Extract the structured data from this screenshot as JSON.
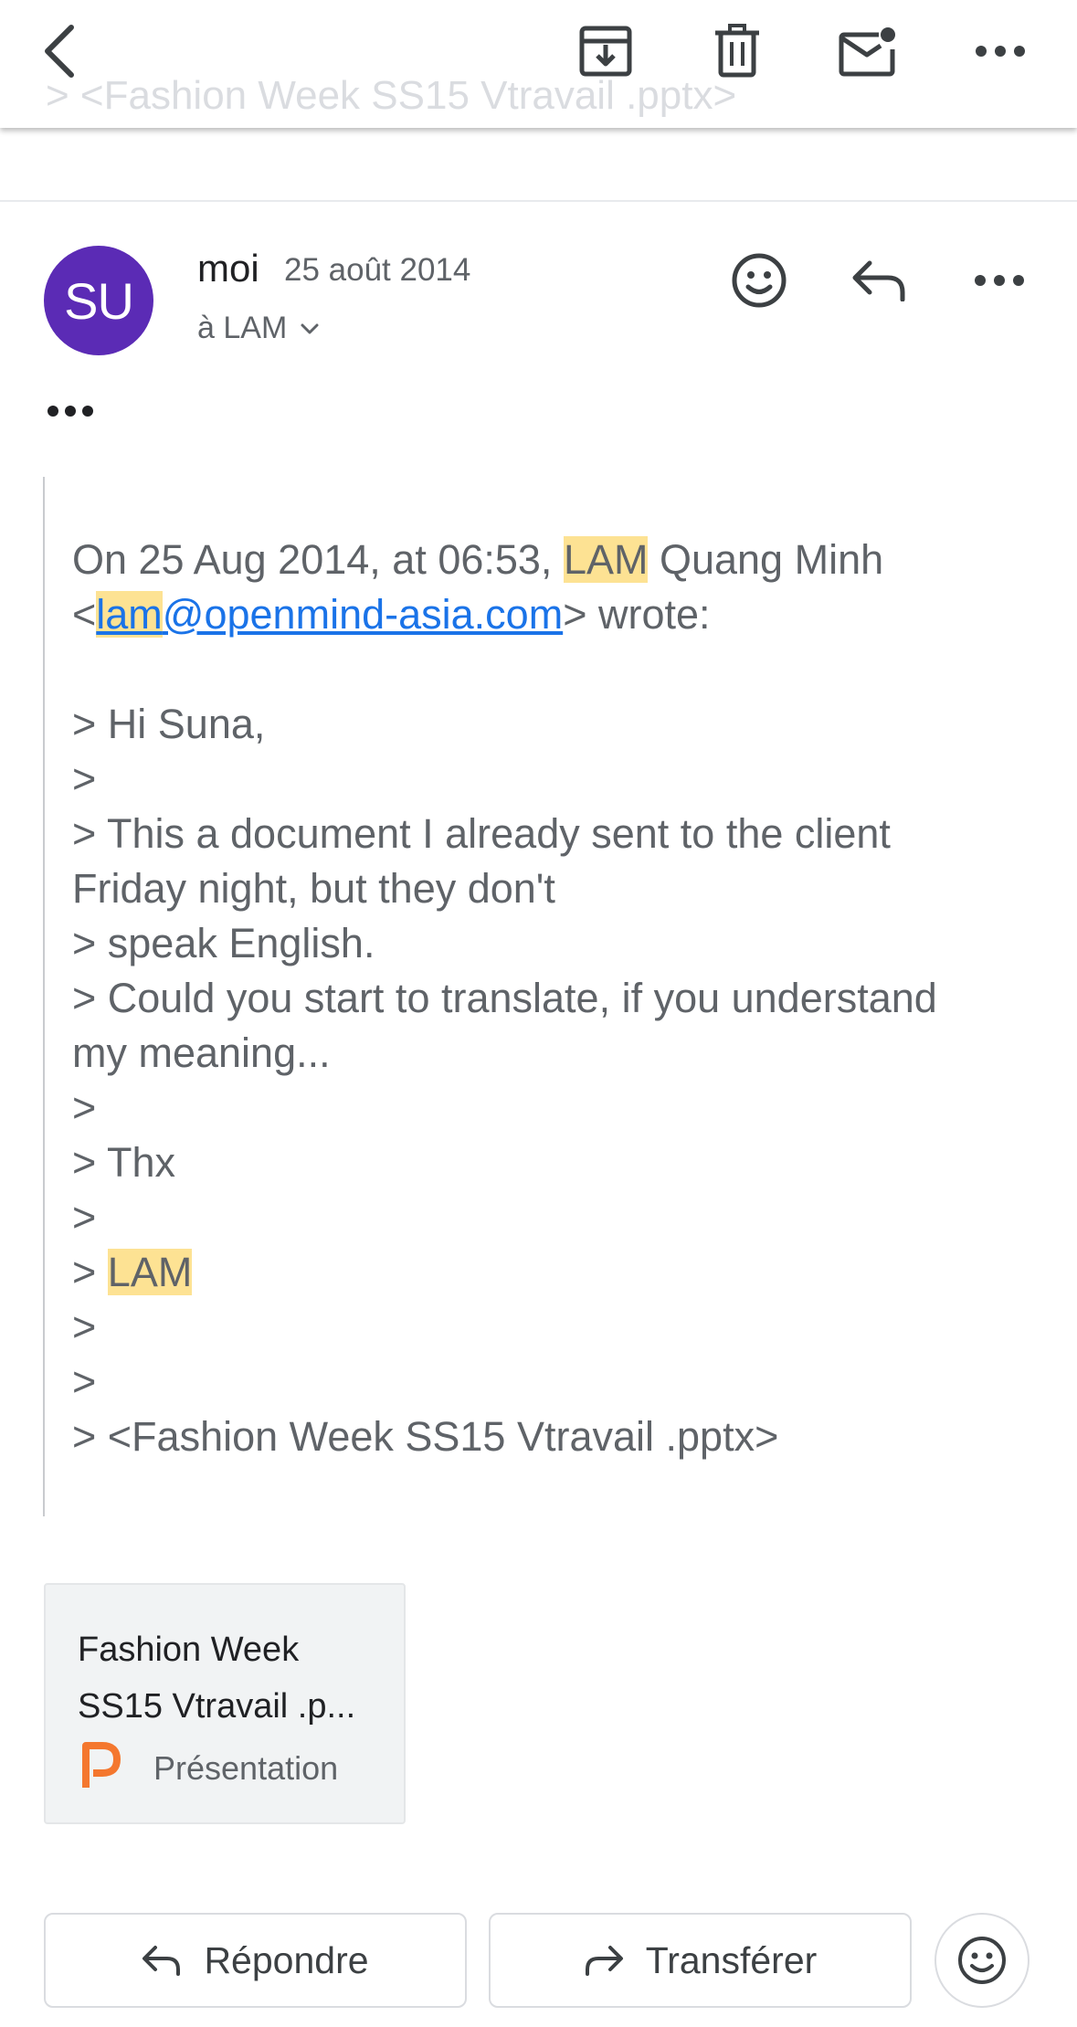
{
  "toolbar": {
    "scrolled_subject_text": "> <Fashion Week SS15 Vtravail .pptx>",
    "icons": [
      "back-arrow-icon",
      "archive-icon",
      "delete-icon",
      "mark-unread-icon",
      "more-icon"
    ]
  },
  "message": {
    "avatar_initials": "SU",
    "avatar_color": "#5b2bb5",
    "sender": "moi",
    "date": "25 août 2014",
    "recipient": "à LAM",
    "trimmed_content": "•••",
    "quote": {
      "intro_prefix": "On 25 Aug 2014, at 06:53, ",
      "intro_highlight": "LAM",
      "intro_rest": " Quang Minh",
      "lt": "<",
      "email_highlight": "lam",
      "email_rest": "@openmind-asia.com",
      "intro_suffix": "> wrote:",
      "lines": [
        "> Hi Suna,",
        ">",
        "> This a document I already sent to the client",
        "Friday night, but they don't",
        "> speak English.",
        "> Could you start to translate, if you understand",
        "my meaning...",
        ">",
        "> Thx",
        ">"
      ],
      "signature_prefix": "> ",
      "signature_highlight": "LAM",
      "tail_lines": [
        ">",
        ">",
        "> <Fashion Week SS15 Vtravail .pptx>"
      ]
    }
  },
  "attachment": {
    "name": "Fashion Week SS15 Vtravail .p...",
    "type": "Présentation",
    "icon": "presentation-p-icon",
    "icon_color": "#f4772e"
  },
  "actions": {
    "reply": "Répondre",
    "forward": "Transférer"
  },
  "colors": {
    "highlight": "#fde293",
    "link": "#1a73e8"
  }
}
